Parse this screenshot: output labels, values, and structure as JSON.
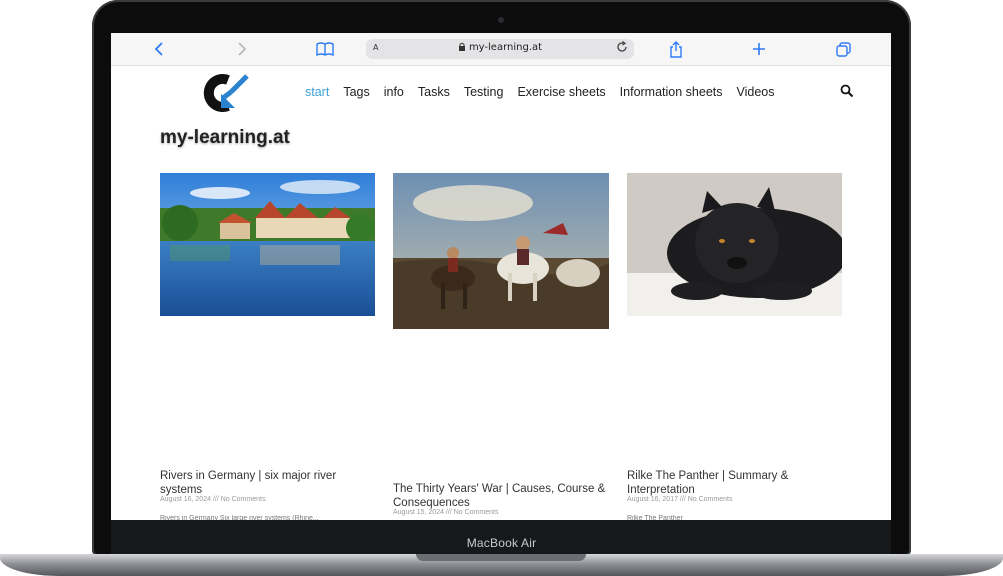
{
  "device": {
    "label": "MacBook Air"
  },
  "browser": {
    "address": "my-learning.at",
    "reader_glyph": "A",
    "icons": [
      "back-icon",
      "forward-icon",
      "bookmarks-icon",
      "lock-icon",
      "reload-icon",
      "share-icon",
      "new-tab-icon",
      "tabs-icon",
      "search-icon"
    ]
  },
  "site": {
    "title": "my-learning.at",
    "nav": [
      "start",
      "Tags",
      "info",
      "Tasks",
      "Testing",
      "Exercise sheets",
      "Information sheets",
      "Videos"
    ],
    "active_nav": "start",
    "accent": "#3aa0d8"
  },
  "posts": [
    {
      "title": "Rivers in Germany | six major river systems",
      "meta": "August 16, 2024 /// No Comments",
      "excerpt": "Rivers in Germany Six large river systems (Rhine..."
    },
    {
      "title": "The Thirty Years' War | Causes, Course & Consequences",
      "meta": "August 15, 2024 /// No Comments",
      "excerpt": ""
    },
    {
      "title": "Rilke The Panther | Summary & Interpretation",
      "meta": "August 16, 2017 /// No Comments",
      "excerpt": "Rilke The Panther"
    }
  ]
}
